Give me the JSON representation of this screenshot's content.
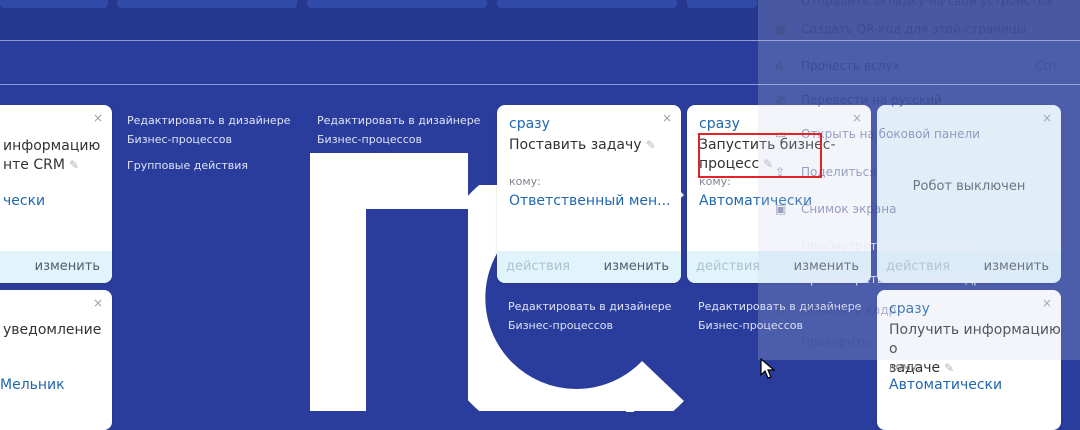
{
  "top_menu": {
    "items": [
      {
        "label": "Отправить вкладку на свои устройства",
        "icon": "send-icon"
      },
      {
        "label": "Создать QR-код для этой страницы",
        "icon": "qr-icon"
      },
      {
        "label": "Прочесть вслух",
        "icon": "read-aloud-icon",
        "shortcut": "Ctrl"
      },
      {
        "label": "Перевести на русский",
        "icon": "translate-icon"
      },
      {
        "label": "Открыть на боковой панели",
        "icon": "sidepanel-icon"
      },
      {
        "label": "Поделиться",
        "icon": "share-icon"
      },
      {
        "label": "Снимок экрана",
        "icon": "screenshot-icon"
      },
      {
        "label": "Просмотреть исходный код",
        "icon": ""
      },
      {
        "label": "Просмотреть источник кадра",
        "icon": ""
      },
      {
        "label": "Обновить кадр",
        "icon": "refresh-icon"
      },
      {
        "label": "Проверить",
        "icon": "inspect-icon"
      }
    ]
  },
  "designer_links": [
    {
      "line1": "Редактировать в дизайнере",
      "line2": "Бизнес-процессов"
    },
    {
      "line1": "Редактировать в дизайнере",
      "line2": "Бизнес-процессов"
    },
    {
      "line1": "Редактировать в дизайнере",
      "line2": "Бизнес-процессов"
    },
    {
      "line1": "Редактировать в дизайнере",
      "line2": "Бизнес-процессов"
    }
  ],
  "group_actions": "Групповые действия",
  "cards": {
    "c1": {
      "title1": "информацию",
      "title2": "нте CRM",
      "assignee": "чески",
      "edit": "изменить"
    },
    "c2": {
      "when": "сразу",
      "title": "Поставить задачу",
      "to": "кому:",
      "assignee": "Ответственный мен...",
      "actions": "действия",
      "edit": "изменить"
    },
    "c3": {
      "when": "сразу",
      "title1": "Запустить бизнес-",
      "title2": "процесс",
      "to": "кому:",
      "assignee": "Автоматически",
      "actions": "действия",
      "edit": "изменить"
    },
    "c4": {
      "status": "Робот выключен",
      "actions": "действия",
      "edit": "изменить"
    },
    "c5": {
      "title": "уведомление",
      "assignee": "Мельник"
    },
    "c6": {
      "when": "сразу",
      "title1": "Получить информацию о",
      "title2": "задаче",
      "to": "кому:",
      "assignee": "Автоматически"
    }
  },
  "close_glyph": "×",
  "pencil_glyph": "✎"
}
